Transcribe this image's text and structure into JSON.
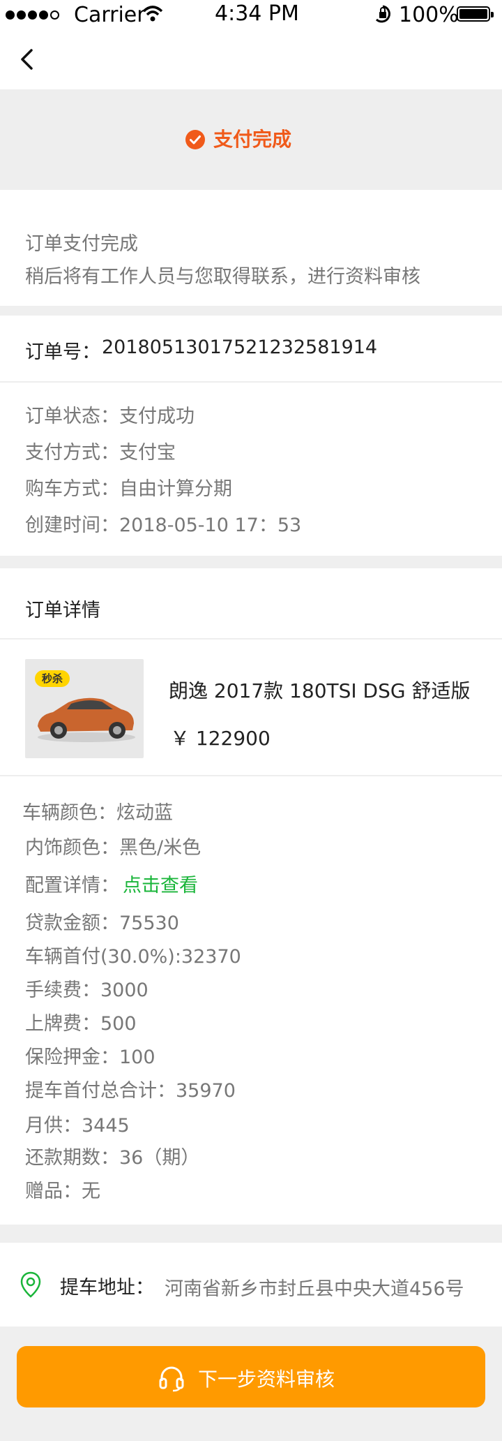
{
  "status_bar": {
    "carrier": "Carrier",
    "time": "4:34 PM",
    "battery": "100%"
  },
  "nav": {
    "back_icon": "chevron-left-icon"
  },
  "banner": {
    "icon": "check-circle-icon",
    "text": "支付完成",
    "accent_color": "#f05a1a"
  },
  "notice": {
    "line1": "订单支付完成",
    "line2": "稍后将有工作人员与您取得联系，进行资料审核"
  },
  "order": {
    "number_label": "订单号：",
    "number": "20180513017521232581914",
    "status": "订单状态：支付成功",
    "payment": "支付方式：支付宝",
    "purchase": "购车方式：自由计算分期",
    "created": "创建时间：2018-05-10  17：53"
  },
  "detail": {
    "title": "订单详情",
    "badge": "秒杀",
    "car_name": "朗逸  2017款 180TSI DSG 舒适版",
    "price": "￥  122900",
    "color": "车辆颜色：炫动蓝",
    "interior": "内饰颜色：黑色/米色",
    "config_label": "配置详情：",
    "config_link": "点击查看",
    "loan": "贷款金额：75530",
    "down_payment": "车辆首付(30.0%):32370",
    "fee": "手续费：3000",
    "plate": "上牌费：500",
    "deposit": "保险押金：100",
    "total_down": "提车首付总合计：35970",
    "monthly": "月供：3445",
    "periods": "还款期数：36（期）",
    "gift": "赠品：无"
  },
  "pickup": {
    "icon": "location-pin-icon",
    "label": "提车地址：",
    "address": "河南省新乡市封丘县中央大道456号"
  },
  "footer": {
    "icon": "headset-icon",
    "button": "下一步资料审核",
    "button_color": "#ff9a00"
  },
  "colors": {
    "link": "#1ab53a",
    "accent": "#f05a1a",
    "primary_button": "#ff9a00"
  }
}
